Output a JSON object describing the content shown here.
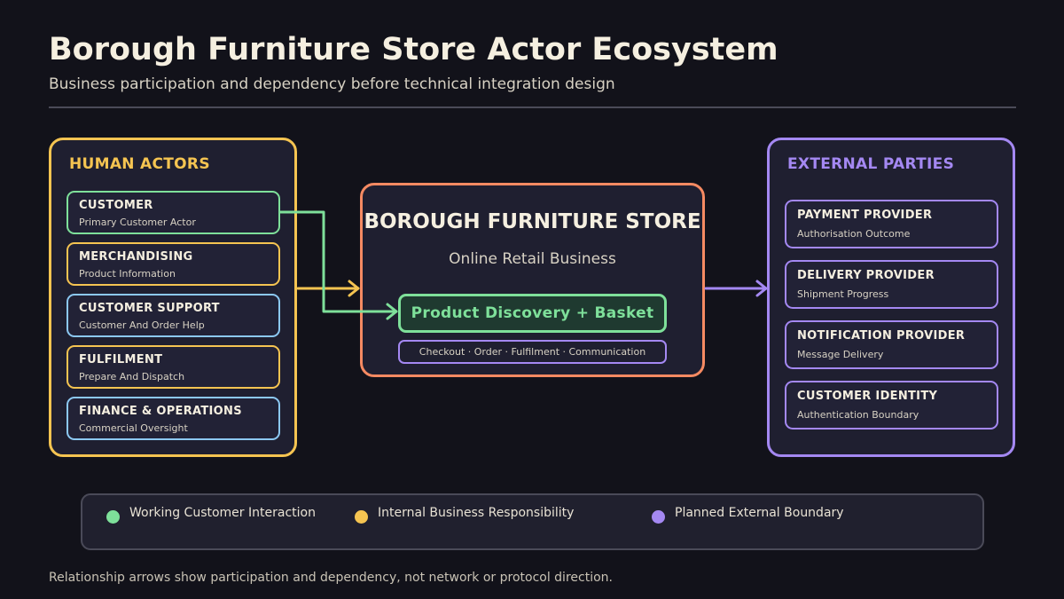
{
  "header": {
    "title": "Borough Furniture Store Actor Ecosystem",
    "subtitle": "Business participation and dependency before technical integration design"
  },
  "human_actors": {
    "title": "HUMAN ACTORS",
    "items": [
      {
        "title": "CUSTOMER",
        "subtitle": "Primary Customer Actor",
        "color": "#7ee09a"
      },
      {
        "title": "MERCHANDISING",
        "subtitle": "Product Information",
        "color": "#f5c451"
      },
      {
        "title": "CUSTOMER SUPPORT",
        "subtitle": "Customer And Order Help",
        "color": "#8cc8f2"
      },
      {
        "title": "FULFILMENT",
        "subtitle": "Prepare And Dispatch",
        "color": "#f5c451"
      },
      {
        "title": "FINANCE & OPERATIONS",
        "subtitle": "Commercial Oversight",
        "color": "#8cc8f2"
      }
    ]
  },
  "store": {
    "title": "BOROUGH FURNITURE STORE",
    "subtitle": "Online Retail Business",
    "primary_capability": "Product Discovery + Basket",
    "secondary_capabilities": "Checkout · Order · Fulfilment · Communication"
  },
  "external_parties": {
    "title": "EXTERNAL PARTIES",
    "items": [
      {
        "title": "PAYMENT PROVIDER",
        "subtitle": "Authorisation Outcome"
      },
      {
        "title": "DELIVERY PROVIDER",
        "subtitle": "Shipment Progress"
      },
      {
        "title": "NOTIFICATION PROVIDER",
        "subtitle": "Message Delivery"
      },
      {
        "title": "CUSTOMER IDENTITY",
        "subtitle": "Authentication Boundary"
      }
    ]
  },
  "legend": {
    "items": [
      {
        "label": "Working Customer Interaction",
        "color": "#7ee09a"
      },
      {
        "label": "Internal Business Responsibility",
        "color": "#f5c451"
      },
      {
        "label": "Planned External Boundary",
        "color": "#a488f2"
      }
    ]
  },
  "footnote": "Relationship arrows show participation and dependency, not network or protocol direction.",
  "colors": {
    "background": "#12121a",
    "human": "#f5c451",
    "customer": "#7ee09a",
    "external": "#a488f2",
    "store": "#f58a62",
    "support": "#8cc8f2"
  }
}
